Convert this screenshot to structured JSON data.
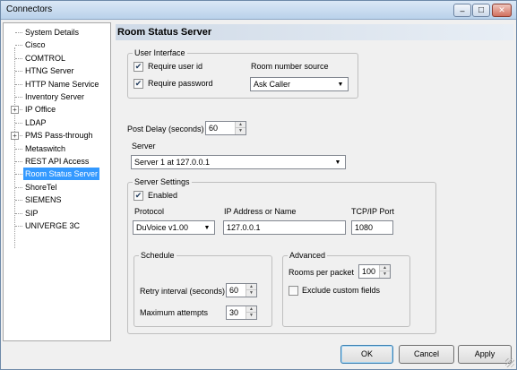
{
  "window": {
    "title": "Connectors",
    "minimize_glyph": "–",
    "maximize_glyph": "□",
    "close_glyph": "✕"
  },
  "sidebar": {
    "items": [
      {
        "label": "System Details"
      },
      {
        "label": "Cisco"
      },
      {
        "label": "COMTROL"
      },
      {
        "label": "HTNG Server"
      },
      {
        "label": "HTTP Name Service"
      },
      {
        "label": "Inventory Server"
      },
      {
        "label": "IP Office",
        "expander": "+"
      },
      {
        "label": "LDAP"
      },
      {
        "label": "PMS Pass-through",
        "expander": "+"
      },
      {
        "label": "Metaswitch"
      },
      {
        "label": "REST API Access"
      },
      {
        "label": "Room Status Server",
        "selected": true
      },
      {
        "label": "ShoreTel"
      },
      {
        "label": "SIEMENS"
      },
      {
        "label": "SIP"
      },
      {
        "label": "UNIVERGE 3C"
      }
    ]
  },
  "main": {
    "header": "Room Status Server",
    "user_interface": {
      "legend": "User Interface",
      "require_user_id": {
        "label": "Require user id",
        "checked": true,
        "mark": "✔"
      },
      "require_password": {
        "label": "Require password",
        "checked": true,
        "mark": "✔"
      },
      "room_source_label": "Room number source",
      "room_source_value": "Ask Caller"
    },
    "post_delay": {
      "label": "Post Delay (seconds)",
      "value": "60"
    },
    "server": {
      "label": "Server",
      "value": "Server 1 at 127.0.0.1"
    },
    "server_settings": {
      "legend": "Server Settings",
      "enabled": {
        "label": "Enabled",
        "checked": true,
        "mark": "✔"
      },
      "protocol_label": "Protocol",
      "protocol_value": "DuVoice v1.00",
      "ip_label": "IP Address or Name",
      "ip_value": "127.0.0.1",
      "port_label": "TCP/IP Port",
      "port_value": "1080",
      "schedule": {
        "legend": "Schedule",
        "retry_label": "Retry interval (seconds)",
        "retry_value": "60",
        "attempts_label": "Maximum attempts",
        "attempts_value": "30"
      },
      "advanced": {
        "legend": "Advanced",
        "rooms_label": "Rooms per packet",
        "rooms_value": "100",
        "exclude_label": "Exclude custom fields",
        "exclude_checked": false
      }
    }
  },
  "buttons": {
    "ok": "OK",
    "cancel": "Cancel",
    "apply": "Apply"
  },
  "icons": {
    "dropdown_arrow": "▼",
    "spin_up": "▲",
    "spin_down": "▼"
  }
}
